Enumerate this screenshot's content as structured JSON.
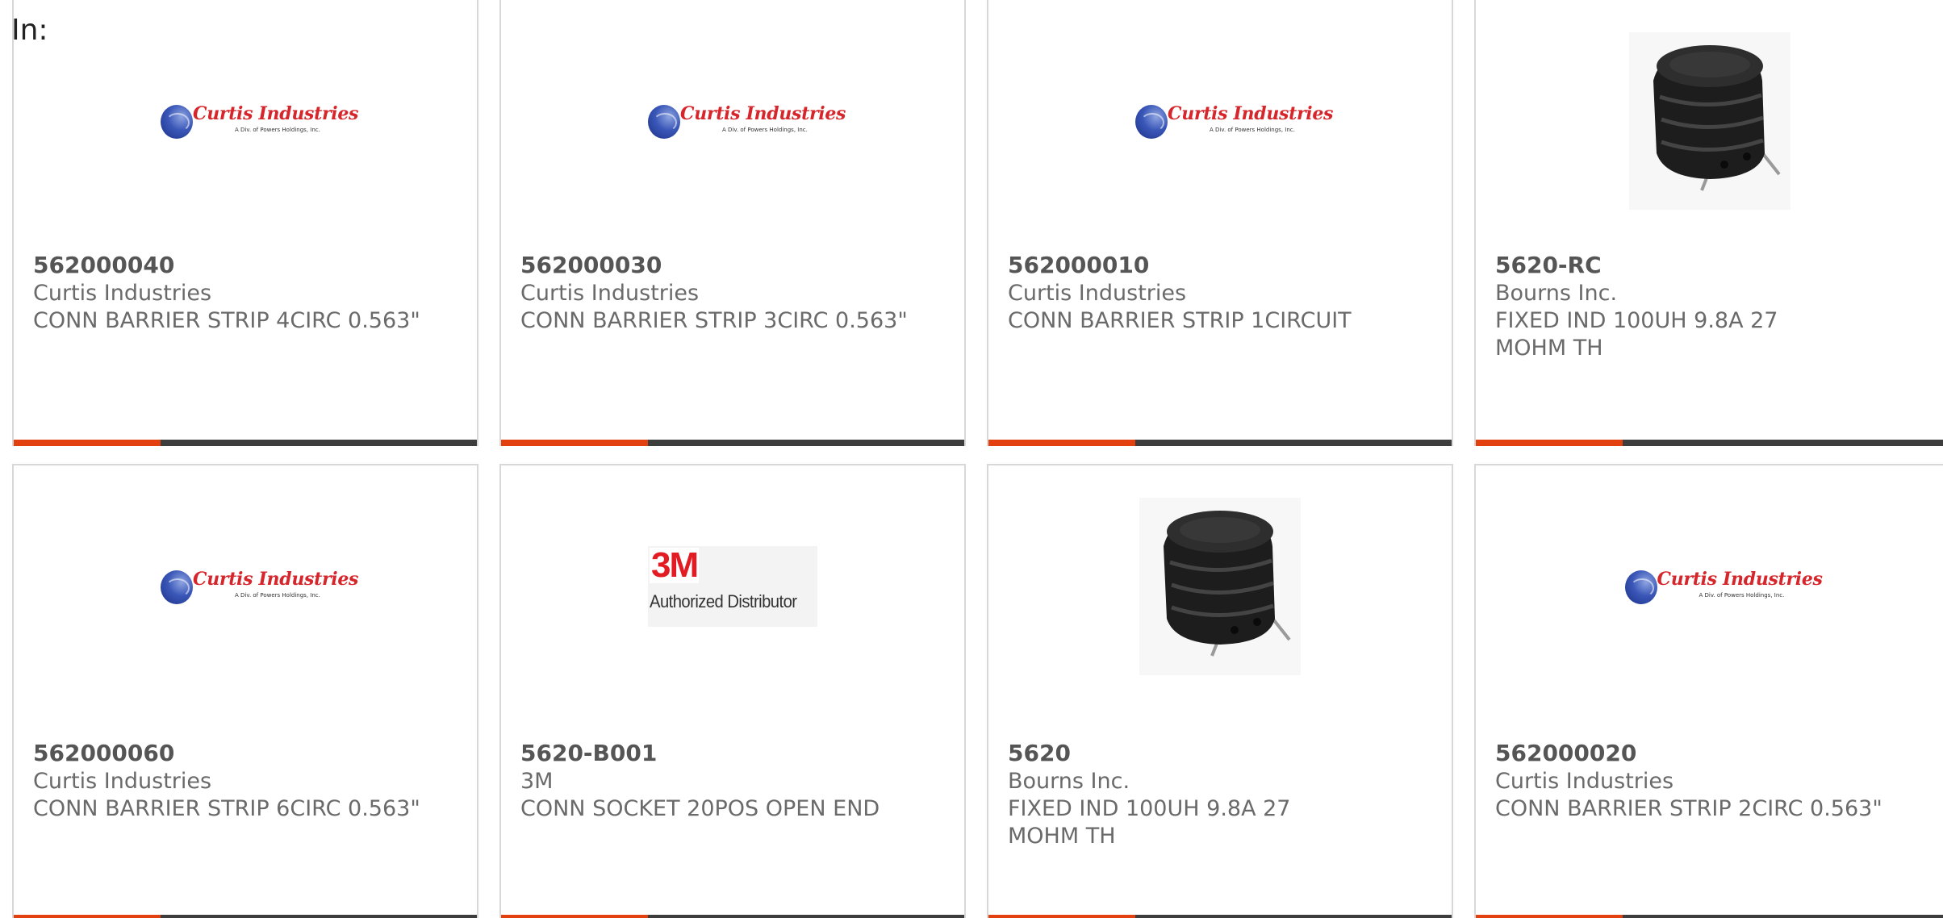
{
  "header": {
    "label": "In:"
  },
  "cards": [
    {
      "part_number": "562000040",
      "manufacturer": "Curtis Industries",
      "description": "CONN BARRIER STRIP 4CIRC 0.563\"",
      "image": "curtis-logo"
    },
    {
      "part_number": "562000030",
      "manufacturer": "Curtis Industries",
      "description": "CONN BARRIER STRIP 3CIRC 0.563\"",
      "image": "curtis-logo"
    },
    {
      "part_number": "562000010",
      "manufacturer": "Curtis Industries",
      "description": "CONN BARRIER STRIP 1CIRCUIT",
      "image": "curtis-logo"
    },
    {
      "part_number": "5620-RC",
      "manufacturer": "Bourns Inc.",
      "description": "FIXED IND 100UH 9.8A 27 MOHM TH",
      "image": "inductor-photo"
    },
    {
      "part_number": "562000060",
      "manufacturer": "Curtis Industries",
      "description": "CONN BARRIER STRIP 6CIRC 0.563\"",
      "image": "curtis-logo"
    },
    {
      "part_number": "5620-B001",
      "manufacturer": "3M",
      "description": "CONN SOCKET 20POS OPEN END",
      "image": "3m-logo"
    },
    {
      "part_number": "5620",
      "manufacturer": "Bourns Inc.",
      "description": "FIXED IND 100UH 9.8A 27 MOHM TH",
      "image": "inductor-photo"
    },
    {
      "part_number": "562000020",
      "manufacturer": "Curtis Industries",
      "description": "CONN BARRIER STRIP 2CIRC 0.563\"",
      "image": "curtis-logo"
    }
  ],
  "logos": {
    "curtis": {
      "name": "Curtis Industries",
      "tagline": "A Div. of Powers Holdings, Inc."
    },
    "mmm": {
      "mark": "3M",
      "tagline": "Authorized Distributor"
    }
  },
  "colors": {
    "accent": "#e2400e",
    "bar": "#3d3d3d",
    "border": "#d8d8d8",
    "text": "#6a6a6a"
  }
}
